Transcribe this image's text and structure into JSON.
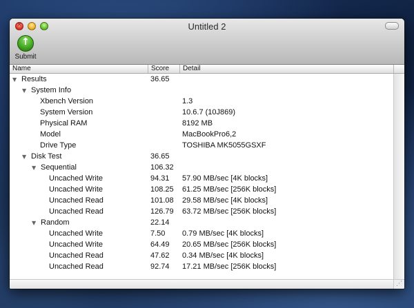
{
  "window": {
    "title": "Untitled 2"
  },
  "toolbar": {
    "submit_label": "Submit"
  },
  "table": {
    "headers": {
      "name": "Name",
      "score": "Score",
      "detail": "Detail"
    },
    "rows": [
      {
        "name": "Results",
        "score": "36.65",
        "detail": "",
        "expanded": true
      },
      {
        "name": "System Info",
        "score": "",
        "detail": "",
        "expanded": true
      },
      {
        "name": "Xbench Version",
        "score": "",
        "detail": "1.3"
      },
      {
        "name": "System Version",
        "score": "",
        "detail": "10.6.7 (10J869)"
      },
      {
        "name": "Physical RAM",
        "score": "",
        "detail": "8192 MB"
      },
      {
        "name": "Model",
        "score": "",
        "detail": "MacBookPro6,2"
      },
      {
        "name": "Drive Type",
        "score": "",
        "detail": "TOSHIBA MK5055GSXF"
      },
      {
        "name": "Disk Test",
        "score": "36.65",
        "detail": "",
        "expanded": true
      },
      {
        "name": "Sequential",
        "score": "106.32",
        "detail": "",
        "expanded": true
      },
      {
        "name": "Uncached Write",
        "score": "94.31",
        "detail": "57.90 MB/sec [4K blocks]"
      },
      {
        "name": "Uncached Write",
        "score": "108.25",
        "detail": "61.25 MB/sec [256K blocks]"
      },
      {
        "name": "Uncached Read",
        "score": "101.08",
        "detail": "29.58 MB/sec [4K blocks]"
      },
      {
        "name": "Uncached Read",
        "score": "126.79",
        "detail": "63.72 MB/sec [256K blocks]"
      },
      {
        "name": "Random",
        "score": "22.14",
        "detail": "",
        "expanded": true
      },
      {
        "name": "Uncached Write",
        "score": "7.50",
        "detail": "0.79 MB/sec [4K blocks]"
      },
      {
        "name": "Uncached Write",
        "score": "64.49",
        "detail": "20.65 MB/sec [256K blocks]"
      },
      {
        "name": "Uncached Read",
        "score": "47.62",
        "detail": "0.34 MB/sec [4K blocks]"
      },
      {
        "name": "Uncached Read",
        "score": "92.74",
        "detail": "17.21 MB/sec [256K blocks]"
      }
    ]
  }
}
